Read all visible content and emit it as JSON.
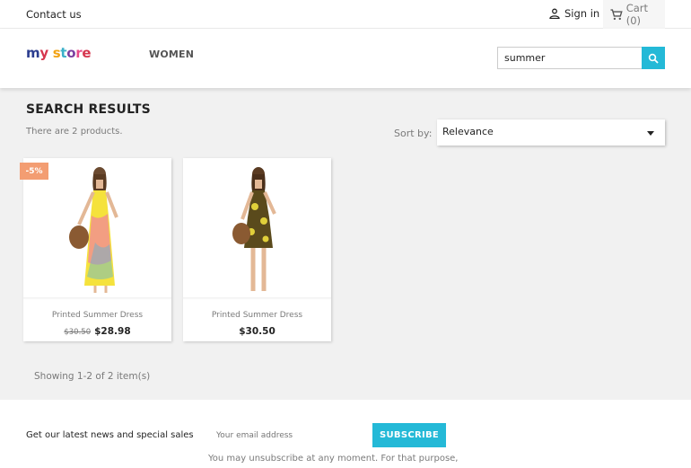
{
  "topbar": {
    "contact": "Contact us",
    "signin": "Sign in",
    "cart": "Cart (0)"
  },
  "header": {
    "logo": "my store",
    "nav_women": "WOMEN",
    "search_value": "summer"
  },
  "results": {
    "title": "SEARCH RESULTS",
    "count": "There are 2 products.",
    "sort_label": "Sort by:",
    "sort_value": "Relevance",
    "showing": "Showing 1-2 of 2 item(s)"
  },
  "products": [
    {
      "name": "Printed Summer Dress",
      "old_price": "$30.50",
      "price": "$28.98",
      "discount": "-5%",
      "dress_color": "#f5e23c"
    },
    {
      "name": "Printed Summer Dress",
      "price": "$30.50",
      "dress_color": "#5a4a1c"
    }
  ],
  "newsletter": {
    "text": "Get our latest news and special sales",
    "placeholder": "Your email address",
    "button": "SUBSCRIBE",
    "note": "You may unsubscribe at any moment. For that purpose,"
  },
  "colors": {
    "accent": "#24b9d7",
    "badge": "#f39d72"
  }
}
